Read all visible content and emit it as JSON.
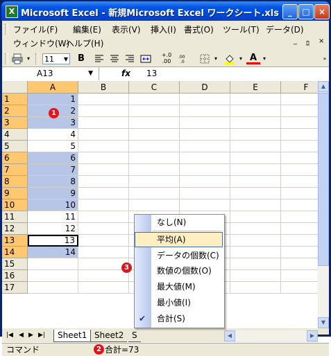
{
  "window": {
    "title": "Microsoft Excel - 新規Microsoft Excel ワークシート.xls",
    "app_icon": "X",
    "min": "_",
    "max": "□",
    "close": "×"
  },
  "menubar": {
    "row1": [
      "ファイル(F)",
      "編集(E)",
      "表示(V)",
      "挿入(I)",
      "書式(O)",
      "ツール(T)",
      "データ(D)"
    ],
    "row2": [
      "ウィンドウ(W)",
      "ヘルプ(H)"
    ],
    "doc_controls": [
      "_",
      "ﾛ",
      "×"
    ]
  },
  "toolbar": {
    "font_size": "11",
    "bold": "B",
    "comma_inc": "+.0\n.00",
    "underline_a": "A"
  },
  "formula_bar": {
    "name_box": "A13",
    "fx": "fx",
    "value": "13"
  },
  "columns": [
    "A",
    "B",
    "C",
    "D",
    "E",
    "F"
  ],
  "rows": [
    "1",
    "2",
    "3",
    "4",
    "5",
    "6",
    "7",
    "8",
    "9",
    "10",
    "11",
    "12",
    "13",
    "14",
    "15",
    "16",
    "17"
  ],
  "cells_a": [
    "1",
    "2",
    "3",
    "4",
    "5",
    "6",
    "7",
    "8",
    "9",
    "10",
    "11",
    "12",
    "13",
    "14",
    "",
    "",
    ""
  ],
  "sheet_tabs": [
    "Sheet1",
    "Sheet2",
    "S"
  ],
  "tab_nav": [
    "|◀",
    "◀",
    "▶",
    "▶|"
  ],
  "status": {
    "mode": "コマンド",
    "sum": "合計=73"
  },
  "popup": {
    "items": [
      "なし(N)",
      "平均(A)",
      "データの個数(C)",
      "数値の個数(O)",
      "最大値(M)",
      "最小値(I)",
      "合計(S)"
    ],
    "hover_index": 1,
    "checked_index": 6,
    "check_mark": "✔"
  },
  "badges": [
    "1",
    "2",
    "3"
  ],
  "colors": {
    "selection": "#b7c6e6",
    "header_selected": "#ffc870",
    "badge": "#e0151b"
  }
}
